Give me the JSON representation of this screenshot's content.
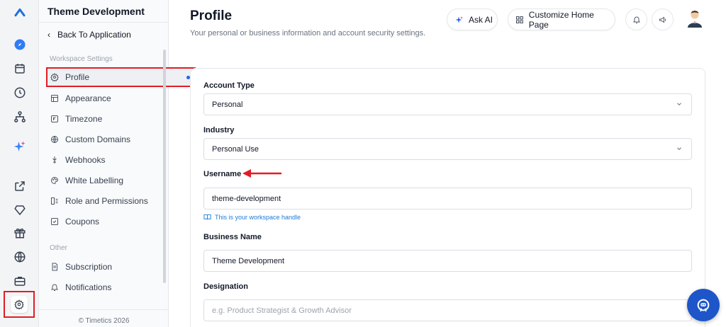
{
  "sidebar": {
    "workspace_title": "Theme Development",
    "back_label": "Back To Application",
    "section_workspace": "Workspace Settings",
    "items": [
      {
        "label": "Profile"
      },
      {
        "label": "Appearance"
      },
      {
        "label": "Timezone"
      },
      {
        "label": "Custom Domains"
      },
      {
        "label": "Webhooks"
      },
      {
        "label": "White Labelling"
      },
      {
        "label": "Role and Permissions"
      },
      {
        "label": "Coupons"
      }
    ],
    "section_other": "Other",
    "other_items": [
      {
        "label": "Subscription"
      },
      {
        "label": "Notifications"
      }
    ],
    "copyright": "© Timetics 2026"
  },
  "header": {
    "title": "Profile",
    "subtitle": "Your personal or business information and account security settings.",
    "ask_ai_label": "Ask AI",
    "customize_label": "Customize Home Page"
  },
  "form": {
    "account_type": {
      "label": "Account Type",
      "value": "Personal"
    },
    "industry": {
      "label": "Industry",
      "value": "Personal Use"
    },
    "username": {
      "label": "Username",
      "value": "theme-development",
      "hint": "This is your workspace handle"
    },
    "business_name": {
      "label": "Business Name",
      "value": "Theme Development"
    },
    "designation": {
      "label": "Designation",
      "placeholder": "e.g. Product Strategist & Growth Advisor"
    }
  },
  "colors": {
    "accent": "#1e56c9",
    "highlight_red": "#e11d24",
    "active_dot": "#2563eb",
    "hint_blue": "#1d7bd8"
  }
}
